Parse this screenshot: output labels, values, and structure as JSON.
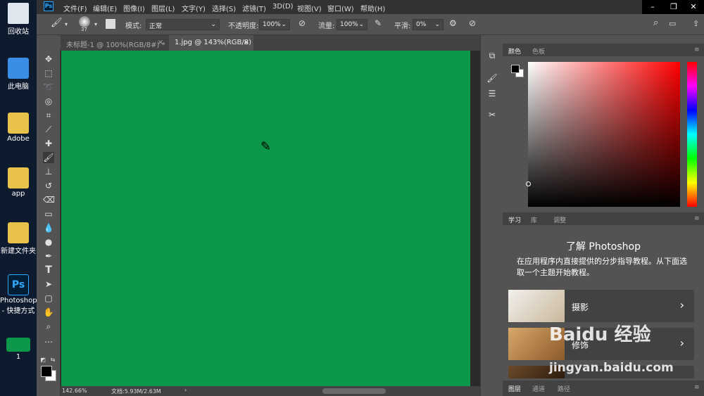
{
  "desktop": {
    "icons": [
      {
        "label": "回收站"
      },
      {
        "label": "此电脑"
      },
      {
        "label": "Adobe"
      },
      {
        "label": "app"
      },
      {
        "label": "新建文件夹"
      },
      {
        "label": "Photoshop - 快捷方式"
      },
      {
        "label": "1"
      }
    ]
  },
  "menubar": {
    "logo": "Ps",
    "items": [
      "文件(F)",
      "编辑(E)",
      "图像(I)",
      "图层(L)",
      "文字(Y)",
      "选择(S)",
      "滤镜(T)",
      "3D(D)",
      "视图(V)",
      "窗口(W)",
      "帮助(H)"
    ]
  },
  "options": {
    "brush_size": "37",
    "mode_label": "模式:",
    "mode_value": "正常",
    "opacity_label": "不透明度:",
    "opacity_value": "100%",
    "flow_label": "流量:",
    "flow_value": "100%",
    "smooth_label": "平滑:",
    "smooth_value": "0%"
  },
  "tabs": [
    {
      "label": "未标题-1 @ 100%(RGB/8#) *"
    },
    {
      "label": "1.jpg @ 143%(RGB/8)"
    }
  ],
  "canvas": {
    "fill_color": "#0d974a"
  },
  "status": {
    "zoom": "142.66%",
    "doc": "文档:5.93M/2.63M"
  },
  "color_panel": {
    "tabs": [
      "颜色",
      "色板"
    ]
  },
  "learn_panel": {
    "tabs": [
      "学习",
      "库",
      "调整"
    ],
    "title": "了解 Photoshop",
    "description": "在应用程序内直接提供的分步指导教程。从下面选取一个主题开始教程。",
    "cards": [
      {
        "label": "摄影"
      },
      {
        "label": "修饰"
      }
    ]
  },
  "layers_panel": {
    "tabs": [
      "图层",
      "通道",
      "路径"
    ]
  },
  "watermark": {
    "text": "Baidu 经验",
    "url": "jingyan.baidu.com"
  }
}
